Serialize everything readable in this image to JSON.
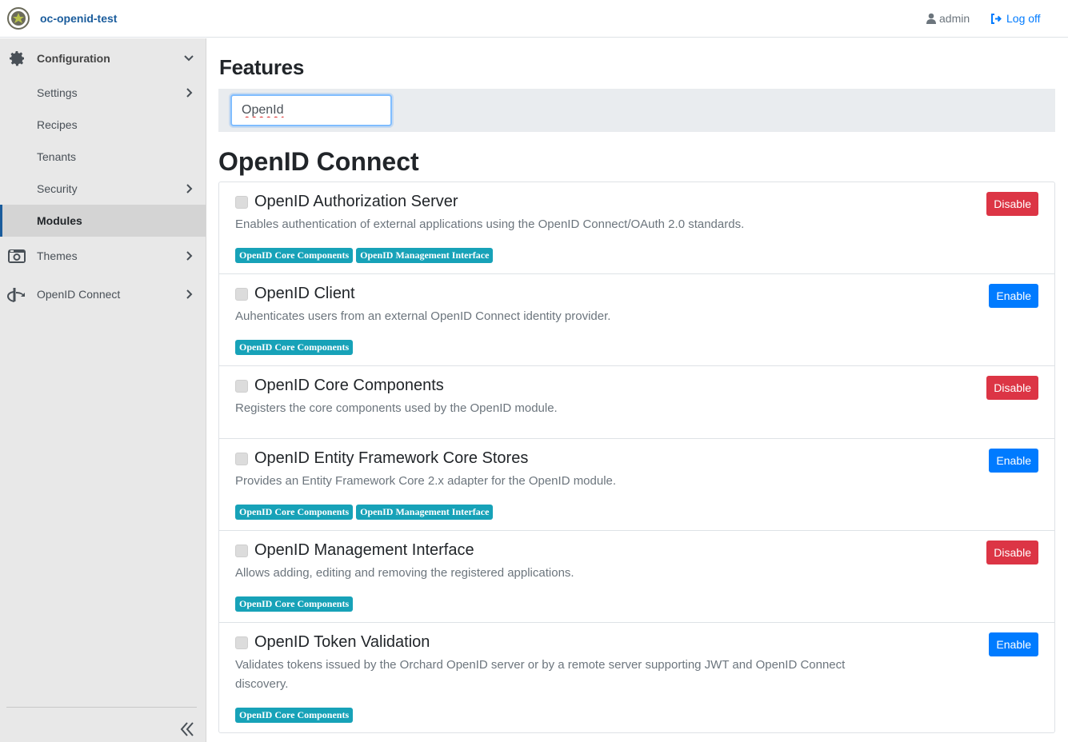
{
  "header": {
    "brand": "oc-openid-test",
    "user": "admin",
    "logoff": "Log off"
  },
  "sidebar": {
    "configuration": "Configuration",
    "items": [
      {
        "label": "Settings",
        "has_children": true
      },
      {
        "label": "Recipes",
        "has_children": false
      },
      {
        "label": "Tenants",
        "has_children": false
      },
      {
        "label": "Security",
        "has_children": true
      },
      {
        "label": "Modules",
        "has_children": false,
        "active": true
      }
    ],
    "themes": "Themes",
    "openid": "OpenID Connect"
  },
  "main": {
    "title": "Features",
    "filter_value": "OpenId",
    "section": "OpenID Connect",
    "features": [
      {
        "name": "OpenID Authorization Server",
        "description": "Enables authentication of external applications using the OpenID Connect/OAuth 2.0 standards.",
        "tags": [
          "OpenID Core Components",
          "OpenID Management Interface"
        ],
        "action": "Disable"
      },
      {
        "name": "OpenID Client",
        "description": "Auhenticates users from an external OpenID Connect identity provider.",
        "tags": [
          "OpenID Core Components"
        ],
        "action": "Enable"
      },
      {
        "name": "OpenID Core Components",
        "description": "Registers the core components used by the OpenID module.",
        "tags": [],
        "action": "Disable"
      },
      {
        "name": "OpenID Entity Framework Core Stores",
        "description": "Provides an Entity Framework Core 2.x adapter for the OpenID module.",
        "tags": [
          "OpenID Core Components",
          "OpenID Management Interface"
        ],
        "action": "Enable"
      },
      {
        "name": "OpenID Management Interface",
        "description": "Allows adding, editing and removing the registered applications.",
        "tags": [
          "OpenID Core Components"
        ],
        "action": "Disable"
      },
      {
        "name": "OpenID Token Validation",
        "description": "Validates tokens issued by the Orchard OpenID server or by a remote server supporting JWT and OpenID Connect discovery.",
        "tags": [
          "OpenID Core Components"
        ],
        "action": "Enable"
      }
    ]
  },
  "colors": {
    "brand": "#1a5c9c",
    "disable": "#dc3545",
    "enable": "#007bff",
    "tag": "#17a2b8"
  }
}
